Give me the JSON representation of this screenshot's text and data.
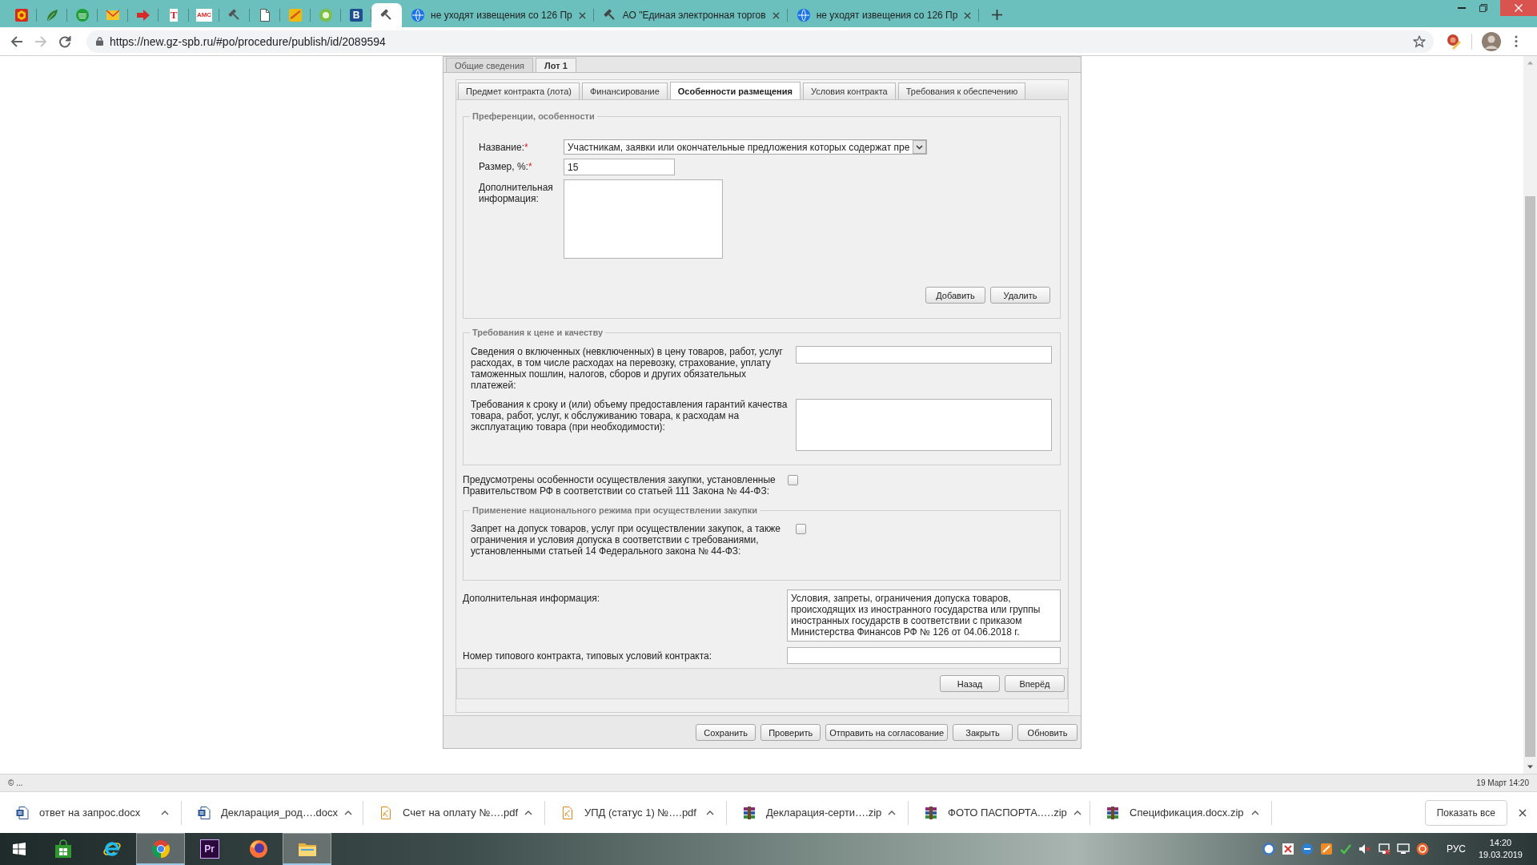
{
  "browser": {
    "pinned_tabs": [
      {
        "kind": "emblem",
        "selected": false
      },
      {
        "kind": "leaf",
        "selected": false
      },
      {
        "kind": "bank",
        "selected": false
      },
      {
        "kind": "mail",
        "selected": false
      },
      {
        "kind": "arrow",
        "selected": false
      },
      {
        "kind": "letter",
        "letter": "T",
        "selected": false
      },
      {
        "kind": "letter",
        "letter": "АМС",
        "selected": false
      },
      {
        "kind": "gavel",
        "selected": false
      },
      {
        "kind": "page",
        "selected": false
      },
      {
        "kind": "swoosh",
        "selected": false
      },
      {
        "kind": "badge",
        "selected": false
      },
      {
        "kind": "tile",
        "letter": "B",
        "selected": false
      },
      {
        "kind": "gavel",
        "selected": true
      }
    ],
    "tabs": [
      {
        "kind": "globe",
        "title": "не уходят извещения со 126 Пр",
        "selected": false
      },
      {
        "kind": "gavel",
        "title": "АО \"Единая электронная торгов",
        "selected": false
      },
      {
        "kind": "globe",
        "title": "не уходят извещения со 126 Пр",
        "selected": false
      }
    ],
    "forward_enabled": false,
    "url": "https://new.gz-spb.ru/#po/procedure/publish/id/2089594"
  },
  "page": {
    "section_tabs": [
      {
        "label": "Общие сведения",
        "selected": false
      },
      {
        "label": "Лот 1",
        "selected": true
      }
    ],
    "lot_tabs": [
      {
        "label": "Предмет контракта (лота)",
        "selected": false
      },
      {
        "label": "Финансирование",
        "selected": false
      },
      {
        "label": "Особенности размещения",
        "selected": true
      },
      {
        "label": "Условия контракта",
        "selected": false
      },
      {
        "label": "Требования к обеспечению",
        "selected": false
      }
    ],
    "preferences": {
      "legend": "Преференции, особенности",
      "fields": [
        {
          "kind": "select",
          "label": "Название:",
          "required_mark": "*",
          "value": "Участникам, заявки или окончательные предложения которых содержат пре"
        },
        {
          "kind": "input",
          "label": "Размер, %:",
          "required_mark": "*",
          "value": "15"
        },
        {
          "kind": "textarea",
          "label": "Дополнительная информация:"
        }
      ],
      "buttons": [
        "Добавить",
        "Удалить"
      ]
    },
    "price_quality": {
      "legend": "Требования к цене и качеству",
      "fields": [
        {
          "kind": "input",
          "label": "Сведения о включенных (невключенных) в цену товаров, работ, услуг расходах, в том числе расходах на перевозку, страхование, уплату таможенных пошлин, налогов, сборов и других обязательных платежей:"
        },
        {
          "kind": "textarea",
          "label": "Требования к сроку и (или) объему предоставления гарантий качества товара, работ, услуг, к обслуживанию товара, к расходам на эксплуатацию товара (при необходимости):"
        }
      ]
    },
    "special_procurement": {
      "label": "Предусмотрены особенности осуществления закупки, установленные Правительством РФ в соответствии со статьей 111 Закона № 44-ФЗ:",
      "checked": false
    },
    "national_regime": {
      "legend": "Применение национального режима при осуществлении закупки",
      "label": "Запрет на допуск товаров, услуг при осуществлении закупок, а также ограничения и условия допуска в соответствии с требованиями, установленными статьей 14 Федерального закона № 44-ФЗ:",
      "checked": false
    },
    "additional_info": {
      "label": "Дополнительная информация:",
      "value": "Условия, запреты, ограничения допуска товаров, происходящих из иностранного государства или группы иностранных государств в соответствии с приказом Министерства Финансов РФ № 126 от 04.06.2018 г."
    },
    "contract_template": {
      "label": "Номер типового контракта, типовых условий контракта:"
    },
    "nav_buttons": [
      "Назад",
      "Вперёд"
    ],
    "footer_buttons": [
      "Сохранить",
      "Проверить",
      "Отправить на согласование",
      "Закрыть",
      "Обновить"
    ]
  },
  "status_bar": {
    "left": "© ...",
    "right": "19 Март 14:20"
  },
  "downloads": {
    "items": [
      {
        "kind": "docx",
        "name": "ответ на запрос.docx"
      },
      {
        "kind": "docx",
        "name": "Декларация_род….docx"
      },
      {
        "kind": "pdf",
        "name": "Счет на оплату №….pdf"
      },
      {
        "kind": "pdf",
        "name": "УПД (статус 1) №….pdf"
      },
      {
        "kind": "zip",
        "name": "Декларация-серти….zip"
      },
      {
        "kind": "zip",
        "name": "ФОТО ПАСПОРТА.….zip"
      },
      {
        "kind": "zip",
        "name": "Спецификация.docx.zip"
      }
    ],
    "show_all": "Показать все"
  },
  "taskbar": {
    "apps": [
      {
        "kind": "store",
        "active": false
      },
      {
        "kind": "ie",
        "active": false
      },
      {
        "kind": "chrome",
        "active": true
      },
      {
        "kind": "premiere",
        "label": "Pr",
        "active": false
      },
      {
        "kind": "firefox",
        "active": false
      },
      {
        "kind": "explorer",
        "active": true
      }
    ],
    "language": "РУС",
    "time": "14:20",
    "date": "19.03.2019"
  }
}
